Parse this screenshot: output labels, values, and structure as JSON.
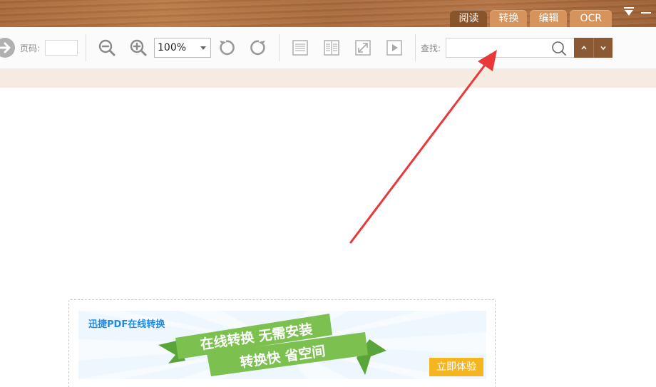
{
  "tabs": [
    {
      "label": "阅读",
      "active": true
    },
    {
      "label": "转换",
      "active": false
    },
    {
      "label": "编辑",
      "active": false
    },
    {
      "label": "OCR",
      "active": false
    }
  ],
  "toolbar": {
    "page_label": "页码:",
    "page_value": "",
    "zoom_value": "100%",
    "find_label": "查找:",
    "find_value": ""
  },
  "ad": {
    "title": "迅捷PDF在线转换",
    "line1": "在线转换 无需安装",
    "line2": "转换快  省空间",
    "cta": "立即体验"
  },
  "colors": {
    "accent_brown": "#8b5a34",
    "tab_inactive": "#d6945c",
    "annotation_red": "#e8383a",
    "ribbon_green": "#7cc04f",
    "cta_yellow": "#f5b51e"
  }
}
